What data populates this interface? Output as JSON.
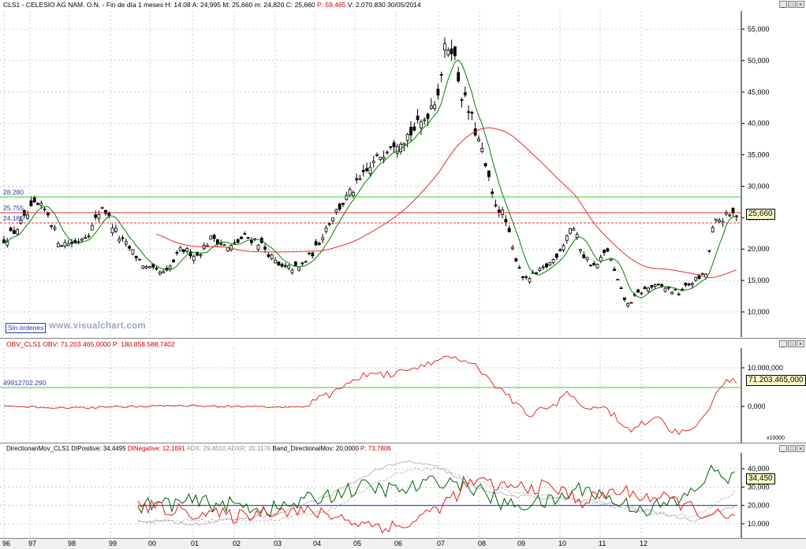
{
  "header": {
    "symbol": "CLS1 - CELESIO AG NAM. O.N. - Fin de día 1 meses",
    "h_label": "H:",
    "h_value": "14:08",
    "a_label": "A:",
    "a_value": "24,995",
    "m_label": "M:",
    "m_value": "25,660",
    "mm_label": "m:",
    "mm_value": "24,820",
    "c_label": "C:",
    "c_value": "25,660",
    "p_label": "P:",
    "p_value": "59,465",
    "v_label": "V:",
    "v_value": "2.070.830",
    "date": "30/05/2014"
  },
  "window_buttons": {
    "min": "_",
    "max": "□",
    "close": "×"
  },
  "price_panel": {
    "hline_labels": {
      "green": "28.280",
      "red": "25.755",
      "red_dashed": "24.185"
    },
    "last_price": "25,660",
    "sin_ordenes": "Sin órdenes",
    "watermark": "www.visualchart.com",
    "yticks": [
      "55,000",
      "50,000",
      "45,000",
      "40,000",
      "35,000",
      "30,000",
      "25,000",
      "20,000",
      "15,000",
      "10,000"
    ]
  },
  "obv_panel": {
    "legend_name": "OBV_CLS1",
    "legend_obv": "OBV: 71.203.465,0000",
    "legend_p": "P: 180.858.588,7402",
    "hline_label": "49912702.290",
    "last_value": "71.203.465,000",
    "yticks": [
      "10.000,000",
      "0,000"
    ],
    "scale": "x10000"
  },
  "dm_panel": {
    "legend_name": "DirectionanMov_CLS1",
    "legend_dip": "DIPositive: 34,4495",
    "legend_din": "DINegative: 12,1691",
    "legend_adx": "ADX: 29,4610",
    "legend_adxr": "ADXR: 20,1176",
    "legend_band": "Band_DirectionalMov: 20,0000",
    "legend_p": "P: 73,7806",
    "last_value": "34,450",
    "yticks": [
      "40,000",
      "30,000",
      "20,000",
      "10,000"
    ]
  },
  "xaxis": {
    "labels": [
      "96",
      "97",
      "98",
      "99",
      "00",
      "01",
      "02",
      "03",
      "04",
      "05",
      "06",
      "07",
      "08",
      "09",
      "10",
      "11",
      "12"
    ]
  },
  "colors": {
    "price_bar": "#000000",
    "ma_short": "#008000",
    "ma_long": "#e03030",
    "hline_green": "#33cc33",
    "hline_red": "#e03030",
    "obv": "#e03030",
    "di_pos": "#006000",
    "di_neg": "#e02020",
    "adx": "#b8b8b8",
    "band": "#2040c0"
  },
  "chart_data": [
    {
      "type": "candlestick",
      "title": "CLS1 - CELESIO AG NAM. O.N. - Fin de día 1 meses",
      "x": [
        "96",
        "97",
        "98",
        "99",
        "00",
        "01",
        "02",
        "03",
        "04",
        "05",
        "06",
        "07",
        "08",
        "09",
        "10",
        "11",
        "12"
      ],
      "ylim": [
        7,
        57
      ],
      "approx_close_by_year": {
        "96": 22,
        "97": 26,
        "98": 22,
        "99": 21,
        "00": 17,
        "01": 20,
        "02": 22,
        "03": 17,
        "04": 20,
        "05": 28,
        "06": 38,
        "07": 52,
        "08": 30,
        "09": 16,
        "10": 24,
        "11": 17,
        "12": 14
      },
      "hlines": [
        28.28,
        25.755,
        24.185
      ],
      "last": 25.66
    },
    {
      "type": "line",
      "title": "OBV_CLS1",
      "yticks": [
        "10.000,000",
        "0,000"
      ],
      "hline": 49912702.29,
      "last": 71203465.0
    },
    {
      "type": "line",
      "title": "DirectionanMov_CLS1",
      "series": [
        {
          "name": "DIPositive",
          "last": 34.4495
        },
        {
          "name": "DINegative",
          "last": 12.1691
        },
        {
          "name": "ADX",
          "last": 29.461
        },
        {
          "name": "ADXR",
          "last": 20.1176
        },
        {
          "name": "Band_DirectionalMov",
          "last": 20.0
        }
      ],
      "ylim": [
        5,
        45
      ]
    }
  ]
}
